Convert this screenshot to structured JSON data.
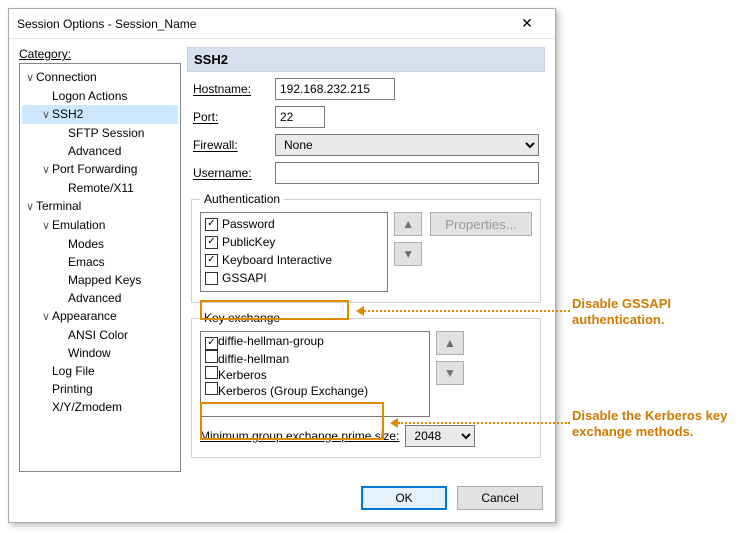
{
  "window": {
    "title": "Session Options - Session_Name",
    "close": "✕"
  },
  "category_label": "Category:",
  "header": "SSH2",
  "tree": [
    {
      "lvl": 1,
      "tw": "∨",
      "label": "Connection"
    },
    {
      "lvl": 2,
      "tw": "",
      "label": "Logon Actions"
    },
    {
      "lvl": 2,
      "tw": "∨",
      "label": "SSH2",
      "sel": true
    },
    {
      "lvl": 3,
      "tw": "",
      "label": "SFTP Session"
    },
    {
      "lvl": 3,
      "tw": "",
      "label": "Advanced"
    },
    {
      "lvl": 2,
      "tw": "∨",
      "label": "Port Forwarding"
    },
    {
      "lvl": 3,
      "tw": "",
      "label": "Remote/X11"
    },
    {
      "lvl": 1,
      "tw": "∨",
      "label": "Terminal"
    },
    {
      "lvl": 2,
      "tw": "∨",
      "label": "Emulation"
    },
    {
      "lvl": 3,
      "tw": "",
      "label": "Modes"
    },
    {
      "lvl": 3,
      "tw": "",
      "label": "Emacs"
    },
    {
      "lvl": 3,
      "tw": "",
      "label": "Mapped Keys"
    },
    {
      "lvl": 3,
      "tw": "",
      "label": "Advanced"
    },
    {
      "lvl": 2,
      "tw": "∨",
      "label": "Appearance"
    },
    {
      "lvl": 3,
      "tw": "",
      "label": "ANSI Color"
    },
    {
      "lvl": 3,
      "tw": "",
      "label": "Window"
    },
    {
      "lvl": 2,
      "tw": "",
      "label": "Log File"
    },
    {
      "lvl": 2,
      "tw": "",
      "label": "Printing"
    },
    {
      "lvl": 2,
      "tw": "",
      "label": "X/Y/Zmodem"
    }
  ],
  "form": {
    "hostname_label": "Hostname:",
    "hostname_value": "192.168.232.215",
    "port_label": "Port:",
    "port_value": "22",
    "firewall_label": "Firewall:",
    "firewall_value": "None",
    "username_label": "Username:",
    "username_value": ""
  },
  "auth": {
    "legend": "Authentication",
    "items": [
      {
        "label": "Password",
        "checked": true
      },
      {
        "label": "PublicKey",
        "checked": true
      },
      {
        "label": "Keyboard Interactive",
        "checked": true
      },
      {
        "label": "GSSAPI",
        "checked": false
      }
    ],
    "properties_label": "Properties..."
  },
  "kex": {
    "legend": "Key exchange",
    "items": [
      {
        "label": "diffie-hellman-group",
        "checked": true
      },
      {
        "label": "diffie-hellman",
        "checked": false
      },
      {
        "label": "Kerberos",
        "checked": false
      },
      {
        "label": "Kerberos (Group Exchange)",
        "checked": false
      }
    ],
    "min_label": "Minimum group exchange prime size:",
    "min_value": "2048"
  },
  "footer": {
    "ok": "OK",
    "cancel": "Cancel"
  },
  "callouts": {
    "a": "Disable GSSAPI authentication.",
    "b": "Disable the Kerberos key exchange methods."
  }
}
